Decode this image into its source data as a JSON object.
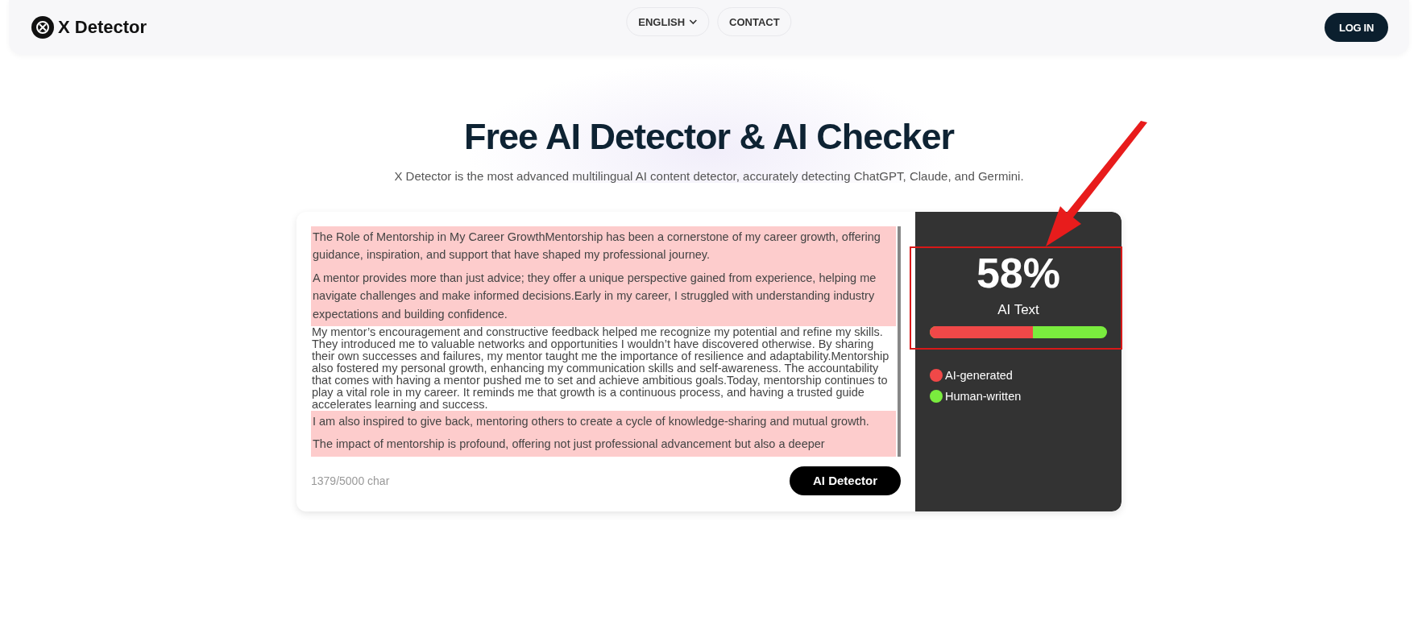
{
  "header": {
    "logo": "X Detector",
    "nav": [
      {
        "label": "ENGLISH",
        "kind": "dropdown"
      },
      {
        "label": "CONTACT",
        "kind": "link"
      }
    ],
    "login": "LOG IN"
  },
  "hero": {
    "title": "Free AI Detector & AI Checker",
    "subtitle": "X Detector is the most advanced multilingual AI content detector, accurately detecting ChatGPT, Claude, and Germini."
  },
  "editor": {
    "paragraphs": [
      {
        "text": "The Role of Mentorship in My Career GrowthMentorship has been a cornerstone of my career growth, offering guidance, inspiration, and support that have shaped my professional journey.",
        "ai_flagged": true
      },
      {
        "text": "A mentor provides more than just advice; they offer a unique perspective gained from experience, helping me navigate challenges and make informed decisions.Early in my career, I struggled with understanding industry expectations and building confidence.",
        "ai_flagged": true
      },
      {
        "text": "My mentor’s encouragement and constructive feedback helped me recognize my potential and refine my skills. They introduced me to valuable networks and opportunities I wouldn’t have discovered otherwise. By sharing their own successes and failures, my mentor taught me the importance of resilience and adaptability.Mentorship also fostered my personal growth, enhancing my communication skills and self-awareness. The accountability that comes with having a mentor pushed me to set and achieve ambitious goals.Today, mentorship continues to play a vital role in my career. It reminds me that growth is a continuous process, and having a trusted guide accelerates learning and success.",
        "ai_flagged": false
      },
      {
        "text": "I am also inspired to give back, mentoring others to create a cycle of knowledge-sharing and mutual growth.",
        "ai_flagged": true
      },
      {
        "text": "The impact of mentorship is profound, offering not just professional advancement but also a deeper",
        "ai_flagged": true
      }
    ],
    "char_count": "1379/5000 char",
    "button": "AI Detector"
  },
  "result": {
    "score": "58%",
    "label": "AI Text",
    "meter": {
      "level": 0.58
    },
    "legend": [
      {
        "label": "AI-generated",
        "color": "#f04848"
      },
      {
        "label": "Human-written",
        "color": "#7aec3e"
      }
    ]
  }
}
